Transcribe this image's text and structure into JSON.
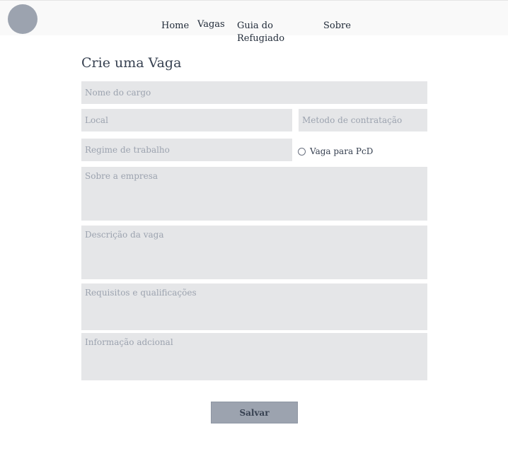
{
  "header": {
    "nav": [
      {
        "label": "Home"
      },
      {
        "label": "Vagas"
      },
      {
        "label": "Guia do Refugiado"
      },
      {
        "label": "Sobre"
      }
    ]
  },
  "form": {
    "title": "Crie uma Vaga",
    "fields": {
      "nome_cargo": {
        "placeholder": "Nome do cargo",
        "value": ""
      },
      "local": {
        "placeholder": "Local",
        "value": ""
      },
      "metodo_contratacao": {
        "placeholder": "Metodo de contratação",
        "value": ""
      },
      "regime_trabalho": {
        "placeholder": "Regime de trabalho",
        "value": ""
      },
      "sobre_empresa": {
        "placeholder": "Sobre a empresa",
        "value": ""
      },
      "descricao_vaga": {
        "placeholder": "Descrição da vaga",
        "value": ""
      },
      "requisitos": {
        "placeholder": "Requisitos e qualificações",
        "value": ""
      },
      "informacao_adicional": {
        "placeholder": "Informação adcional",
        "value": ""
      }
    },
    "pcd_label": "Vaga para PcD",
    "pcd_checked": false,
    "save_label": "Salvar"
  },
  "colors": {
    "field_bg": "#e5e6e8",
    "button_bg": "#9ca3af",
    "avatar_bg": "#9ca3af",
    "header_bg": "#f9f9f9"
  }
}
